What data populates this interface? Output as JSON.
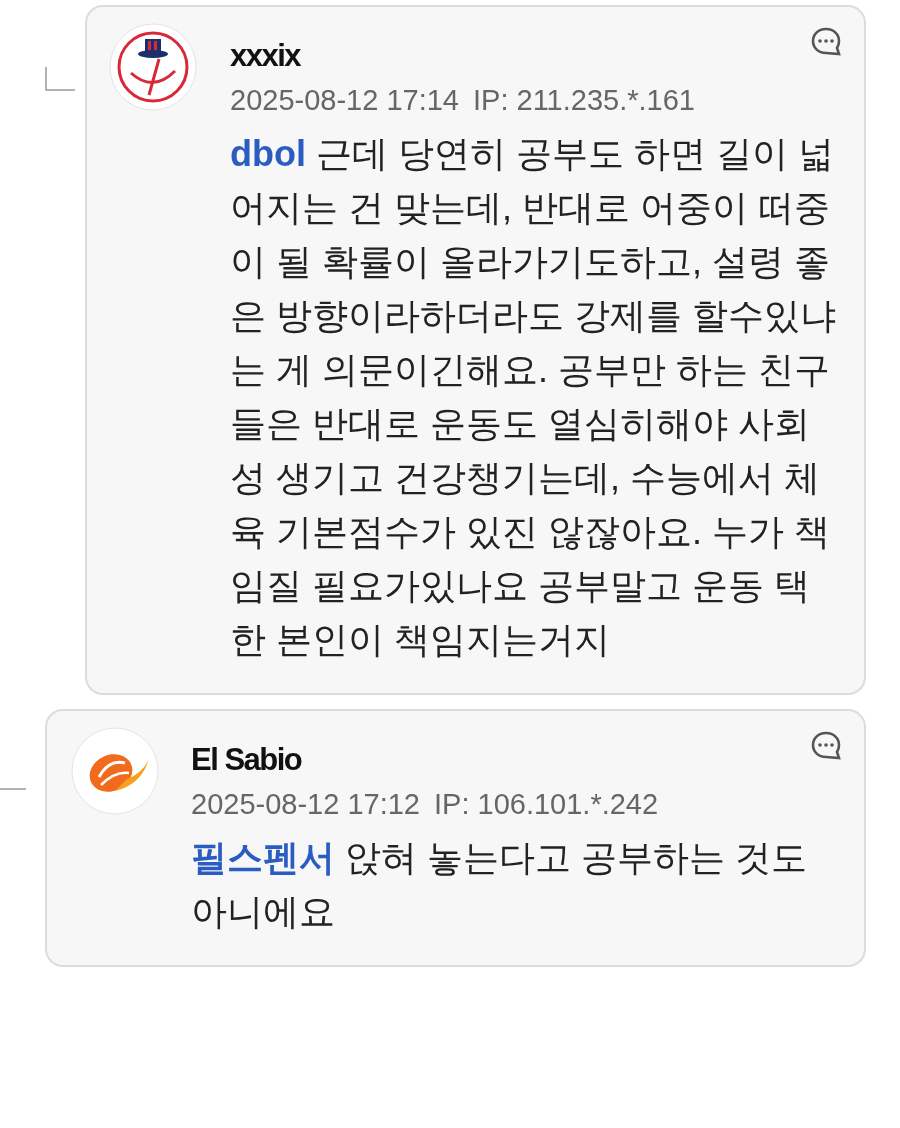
{
  "comments": [
    {
      "kind": "subreply",
      "author": "xxxix",
      "date": "2025-08-12 17:14",
      "ip": "IP: 211.235.*.161",
      "mention": "dbol",
      "text": "근데 당연히 공부도 하면 길이 넓어지는 건 맞는데, 반대로 어중이 떠중이 될 확률이 올라가기도하고, 설령 좋은 방향이라하더라도 강제를 할수있냐는 게 의문이긴해요. 공부만 하는 친구들은 반대로 운동도 열심히해야 사회성 생기고 건강챙기는데, 수능에서 체육 기본점수가 있진 않잖아요. 누가 책임질 필요가있나요 공부말고 운동 택한 본인이 책임지는거지"
    },
    {
      "kind": "reply",
      "author": "El Sabio",
      "date": "2025-08-12 17:12",
      "ip": "IP: 106.101.*.242",
      "mention": "필스펜서",
      "text": "앉혀 놓는다고 공부하는 것도 아니에요"
    }
  ]
}
